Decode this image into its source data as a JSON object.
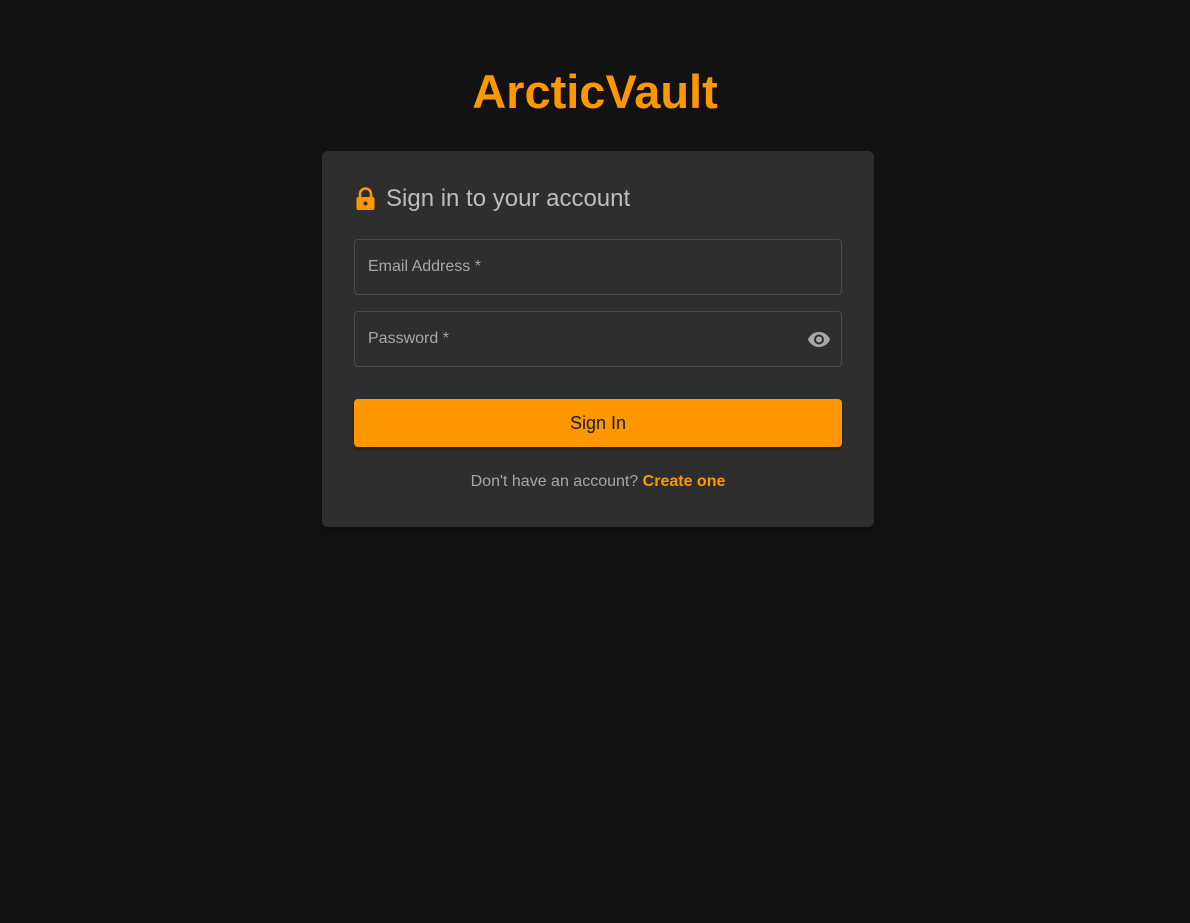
{
  "brand": {
    "name": "ArcticVault",
    "accent_color": "#ff9800"
  },
  "login_card": {
    "title": "Sign in to your account",
    "title_icon": "lock-icon",
    "email_field": {
      "label": "Email Address *",
      "value": ""
    },
    "password_field": {
      "label": "Password *",
      "value": "",
      "toggle_icon": "eye-icon"
    },
    "submit_label": "Sign In",
    "signup_prompt": "Don't have an account?",
    "signup_link": "Create one"
  },
  "colors": {
    "background": "#121212",
    "card": "#2e2e2e",
    "muted_text": "#a8a8a8"
  }
}
